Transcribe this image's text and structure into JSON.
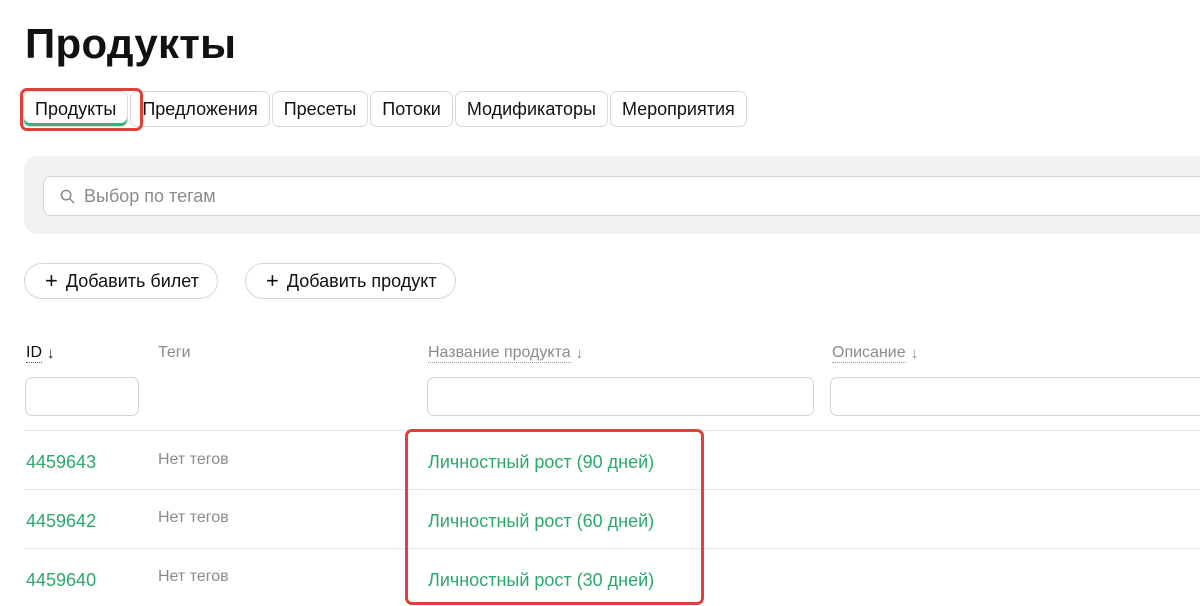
{
  "page": {
    "title": "Продукты"
  },
  "tabs": [
    {
      "label": "Продукты",
      "active": true
    },
    {
      "label": "Предложения",
      "active": false
    },
    {
      "label": "Пресеты",
      "active": false
    },
    {
      "label": "Потоки",
      "active": false
    },
    {
      "label": "Модификаторы",
      "active": false
    },
    {
      "label": "Мероприятия",
      "active": false
    }
  ],
  "search": {
    "placeholder": "Выбор по тегам",
    "value": "",
    "icon": "search-icon"
  },
  "actions": {
    "add_ticket": "Добавить билет",
    "add_product": "Добавить продукт",
    "icon": "plus-icon"
  },
  "table": {
    "columns": {
      "id": {
        "label": "ID",
        "sort": "↓"
      },
      "tags": {
        "label": "Теги"
      },
      "name": {
        "label": "Название продукта",
        "sort": "↓"
      },
      "description": {
        "label": "Описание",
        "sort": "↓"
      }
    },
    "rows": [
      {
        "id": "4459643",
        "tags": "Нет тегов",
        "name": "Личностный рост (90 дней)"
      },
      {
        "id": "4459642",
        "tags": "Нет тегов",
        "name": "Личностный рост (60 дней)"
      },
      {
        "id": "4459640",
        "tags": "Нет тегов",
        "name": "Личностный рост (30 дней)"
      }
    ]
  },
  "colors": {
    "accent": "#2aa96b",
    "highlight": "#e0403a",
    "panel": "#f1f1f3"
  }
}
